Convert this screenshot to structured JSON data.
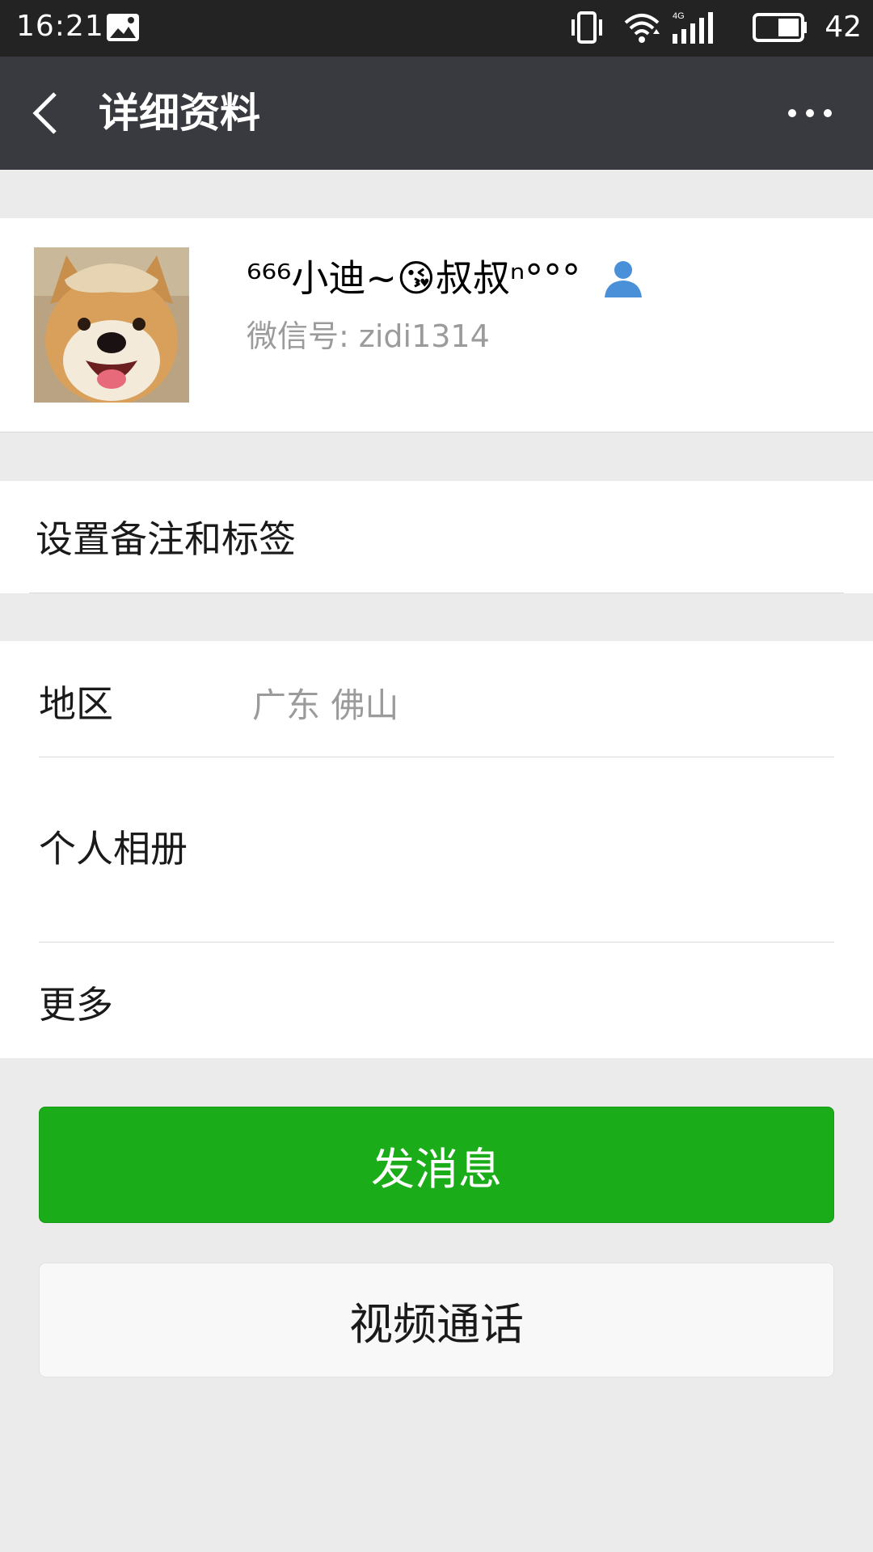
{
  "status_bar": {
    "time": "16:21",
    "battery_level": "42",
    "icons": [
      "image-notification-icon",
      "vibrate-icon",
      "wifi-icon",
      "4g-signal-icon",
      "battery-icon"
    ]
  },
  "header": {
    "title": "详细资料",
    "back_icon": "chevron-left-icon",
    "more_icon": "more-dots-icon"
  },
  "profile": {
    "nickname": "⁶⁶⁶小迪~😘叔叔ⁿ°°°",
    "wechat_id": "微信号: zidi1314",
    "gender_icon": "person-icon"
  },
  "remark": {
    "label": "设置备注和标签"
  },
  "details": {
    "region_label": "地区",
    "region_value": "广东  佛山",
    "album_label": "个人相册",
    "more_label": "更多"
  },
  "actions": {
    "send_message": "发消息",
    "video_call": "视频通话"
  },
  "colors": {
    "header_bg": "#393a3f",
    "status_bg": "#232323",
    "primary_green": "#1aad19",
    "page_bg": "#ebebeb",
    "person_icon_blue": "#4a90d9"
  }
}
